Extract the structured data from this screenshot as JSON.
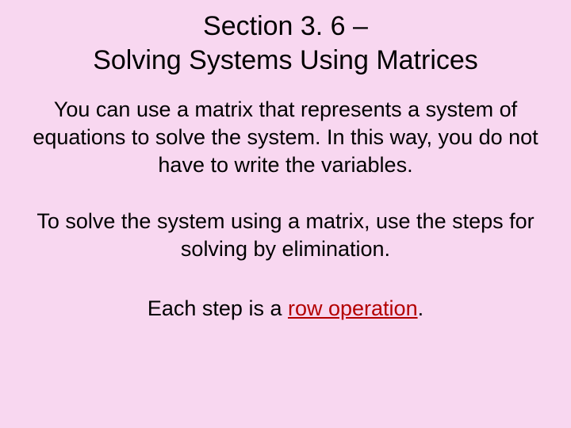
{
  "title_line1": "Section 3. 6 –",
  "title_line2": "Solving Systems Using Matrices",
  "paragraph1": "You can use a matrix that represents a system of equations to solve the system.  In this way, you do not have to write the variables.",
  "paragraph2": "To solve the system using a matrix, use the steps for solving by elimination.",
  "final_prefix": "Each step is a ",
  "final_keyword": "row operation",
  "final_suffix": "."
}
